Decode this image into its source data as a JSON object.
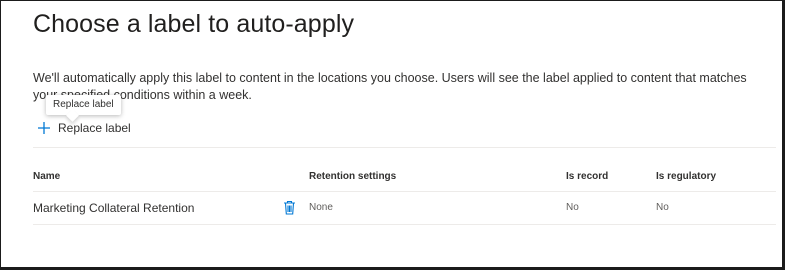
{
  "page": {
    "title": "Choose a label to auto-apply",
    "description": "We'll automatically apply this label to content in the locations you choose. Users will see the label applied to content that matches your specified conditions within a week."
  },
  "tooltip": {
    "text": "Replace label"
  },
  "toolbar": {
    "replace_label": "Replace label",
    "replace_icon": "plus-icon"
  },
  "table": {
    "headers": {
      "name": "Name",
      "retention": "Retention settings",
      "is_record": "Is record",
      "is_regulatory": "Is regulatory"
    },
    "rows": [
      {
        "name": "Marketing Collateral Retention",
        "delete_icon": "trash-icon",
        "retention": "None",
        "is_record": "No",
        "is_regulatory": "No"
      }
    ]
  },
  "colors": {
    "accent": "#0078d4",
    "text_primary": "#201f1e",
    "text_secondary": "#605e5c",
    "divider": "#edebe9"
  }
}
